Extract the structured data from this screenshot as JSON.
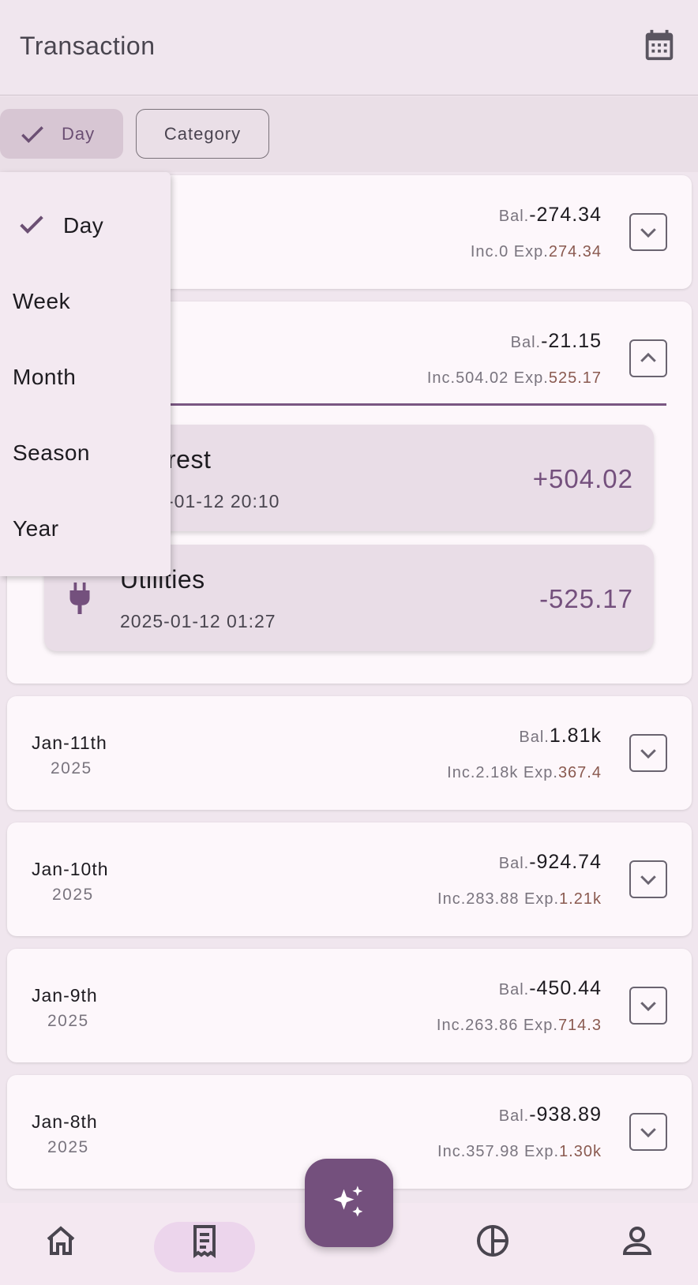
{
  "app_bar": {
    "title": "Transaction",
    "calendar_icon": "calendar-icon"
  },
  "filters": {
    "day_chip": "Day",
    "category_chip": "Category"
  },
  "menu": {
    "items": [
      "Day",
      "Week",
      "Month",
      "Season",
      "Year"
    ],
    "selected": "Day"
  },
  "days": [
    {
      "date": "",
      "year": "",
      "bal_label": "Bal.",
      "bal": "-274.34",
      "inc_label": "Inc.",
      "inc": "0",
      "exp_label": "Exp.",
      "exp": "274.34",
      "expanded": false
    },
    {
      "date": "",
      "year": "",
      "bal_label": "Bal.",
      "bal": "-21.15",
      "inc_label": "Inc.",
      "inc": "504.02",
      "exp_label": "Exp.",
      "exp": "525.17",
      "expanded": true,
      "transactions": [
        {
          "name": "rest",
          "time": "-01-12 20:10",
          "amount": "+504.02"
        },
        {
          "name": "Utilities",
          "time": "2025-01-12 01:27",
          "amount": "-525.17",
          "icon": "plug-icon"
        }
      ]
    },
    {
      "date": "Jan-11th",
      "year": "2025",
      "bal_label": "Bal.",
      "bal": "1.81k",
      "inc_label": "Inc.",
      "inc": "2.18k",
      "exp_label": "Exp.",
      "exp": "367.4",
      "expanded": false
    },
    {
      "date": "Jan-10th",
      "year": "2025",
      "bal_label": "Bal.",
      "bal": "-924.74",
      "inc_label": "Inc.",
      "inc": "283.88",
      "exp_label": "Exp.",
      "exp": "1.21k",
      "expanded": false
    },
    {
      "date": "Jan-9th",
      "year": "2025",
      "bal_label": "Bal.",
      "bal": "-450.44",
      "inc_label": "Inc.",
      "inc": "263.86",
      "exp_label": "Exp.",
      "exp": "714.3",
      "expanded": false
    },
    {
      "date": "Jan-8th",
      "year": "2025",
      "bal_label": "Bal.",
      "bal": "-938.89",
      "inc_label": "Inc.",
      "inc": "357.98",
      "exp_label": "Exp.",
      "exp": "1.30k",
      "expanded": false
    }
  ],
  "bottom_nav": {
    "items": [
      "home-icon",
      "receipt-icon",
      "pie-chart-icon",
      "person-icon"
    ],
    "active": "receipt-icon",
    "fab_icon": "sparkle-icon"
  },
  "colors": {
    "accent": "#74507d",
    "expense": "#8a5a50",
    "background": "#f0e6ee"
  }
}
